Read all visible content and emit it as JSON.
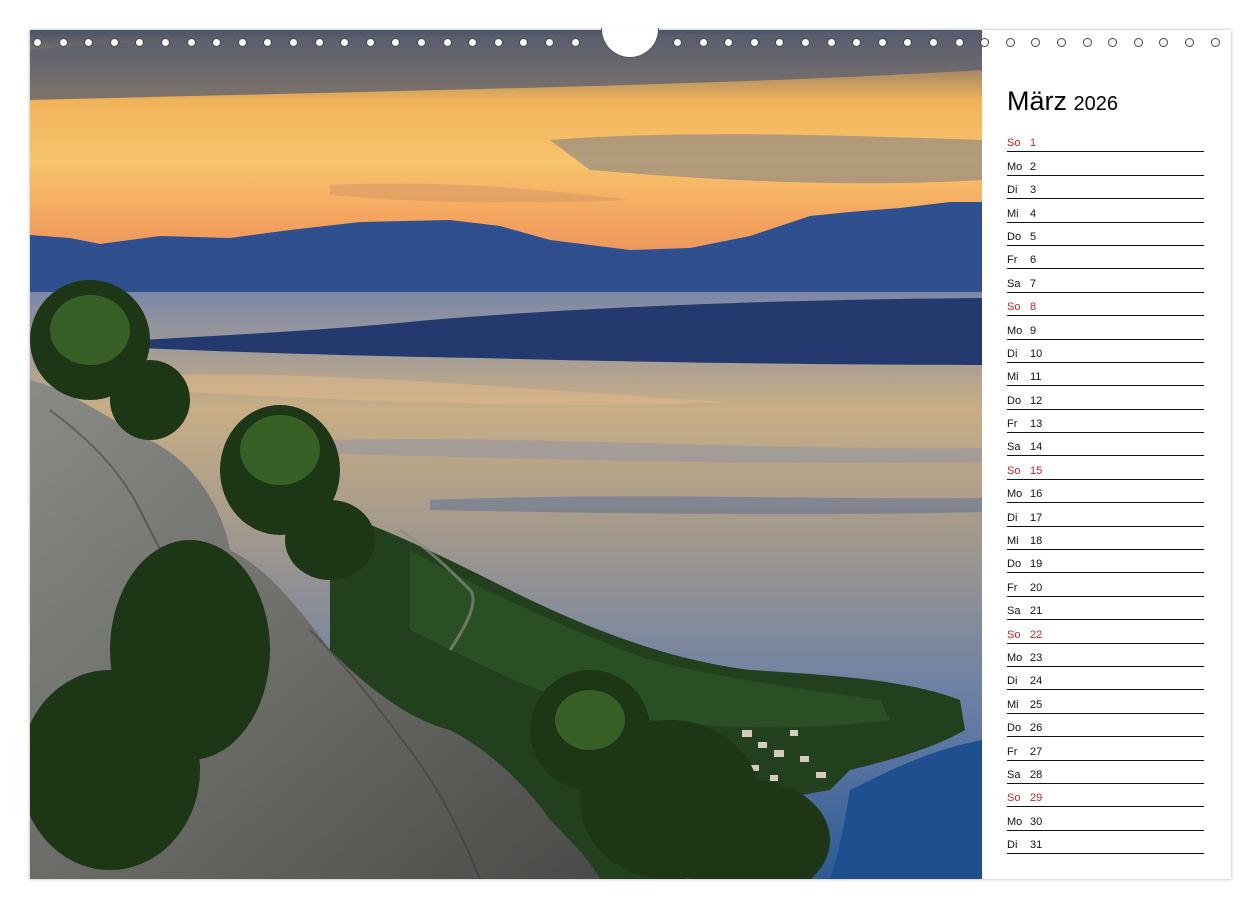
{
  "calendar": {
    "month": "März",
    "year": "2026",
    "days": [
      {
        "abbr": "So",
        "num": "1",
        "sunday": true
      },
      {
        "abbr": "Mo",
        "num": "2",
        "sunday": false
      },
      {
        "abbr": "Di",
        "num": "3",
        "sunday": false
      },
      {
        "abbr": "Mi",
        "num": "4",
        "sunday": false
      },
      {
        "abbr": "Do",
        "num": "5",
        "sunday": false
      },
      {
        "abbr": "Fr",
        "num": "6",
        "sunday": false
      },
      {
        "abbr": "Sa",
        "num": "7",
        "sunday": false
      },
      {
        "abbr": "So",
        "num": "8",
        "sunday": true
      },
      {
        "abbr": "Mo",
        "num": "9",
        "sunday": false
      },
      {
        "abbr": "Di",
        "num": "10",
        "sunday": false
      },
      {
        "abbr": "Mi",
        "num": "11",
        "sunday": false
      },
      {
        "abbr": "Do",
        "num": "12",
        "sunday": false
      },
      {
        "abbr": "Fr",
        "num": "13",
        "sunday": false
      },
      {
        "abbr": "Sa",
        "num": "14",
        "sunday": false
      },
      {
        "abbr": "So",
        "num": "15",
        "sunday": true
      },
      {
        "abbr": "Mo",
        "num": "16",
        "sunday": false
      },
      {
        "abbr": "Di",
        "num": "17",
        "sunday": false
      },
      {
        "abbr": "Mi",
        "num": "18",
        "sunday": false
      },
      {
        "abbr": "Do",
        "num": "19",
        "sunday": false
      },
      {
        "abbr": "Fr",
        "num": "20",
        "sunday": false
      },
      {
        "abbr": "Sa",
        "num": "21",
        "sunday": false
      },
      {
        "abbr": "So",
        "num": "22",
        "sunday": true
      },
      {
        "abbr": "Mo",
        "num": "23",
        "sunday": false
      },
      {
        "abbr": "Di",
        "num": "24",
        "sunday": false
      },
      {
        "abbr": "Mi",
        "num": "25",
        "sunday": false
      },
      {
        "abbr": "Do",
        "num": "26",
        "sunday": false
      },
      {
        "abbr": "Fr",
        "num": "27",
        "sunday": false
      },
      {
        "abbr": "Sa",
        "num": "28",
        "sunday": false
      },
      {
        "abbr": "So",
        "num": "29",
        "sunday": true
      },
      {
        "abbr": "Mo",
        "num": "30",
        "sunday": false
      },
      {
        "abbr": "Di",
        "num": "31",
        "sunday": false
      }
    ]
  },
  "photo": {
    "subject": "coastal-sunset-landscape"
  },
  "colors": {
    "sunday": "#d02020",
    "weekday": "#111111"
  }
}
